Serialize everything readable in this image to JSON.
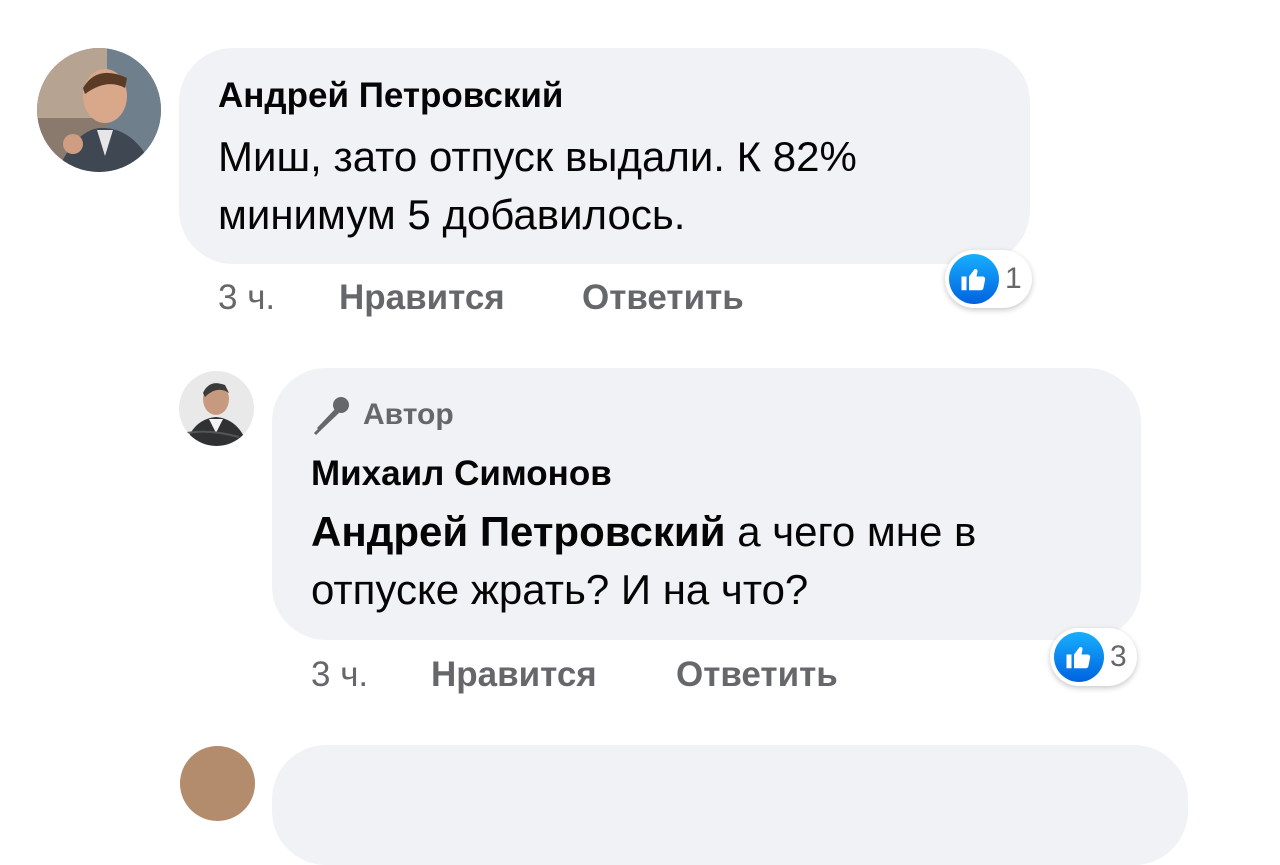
{
  "comments": [
    {
      "author": "Андрей Петровский",
      "text": "Миш, зато отпуск выдали. К 82% минимум 5 добавилось.",
      "time": "3 ч.",
      "like_label": "Нравится",
      "reply_label": "Ответить",
      "reaction_count": "1"
    }
  ],
  "reply": {
    "badge": "Автор",
    "author": "Михаил Симонов",
    "mention": "Андрей Петровский",
    "text": " а чего мне в отпуске жрать? И на что?",
    "time": "3 ч.",
    "like_label": "Нравится",
    "reply_label": "Ответить",
    "reaction_count": "3"
  },
  "colors": {
    "bubble": "#f0f2f5",
    "meta_text": "#65676b",
    "like_blue": "#0866ff"
  },
  "icons": [
    "thumbs-up-icon",
    "microphone-icon"
  ]
}
